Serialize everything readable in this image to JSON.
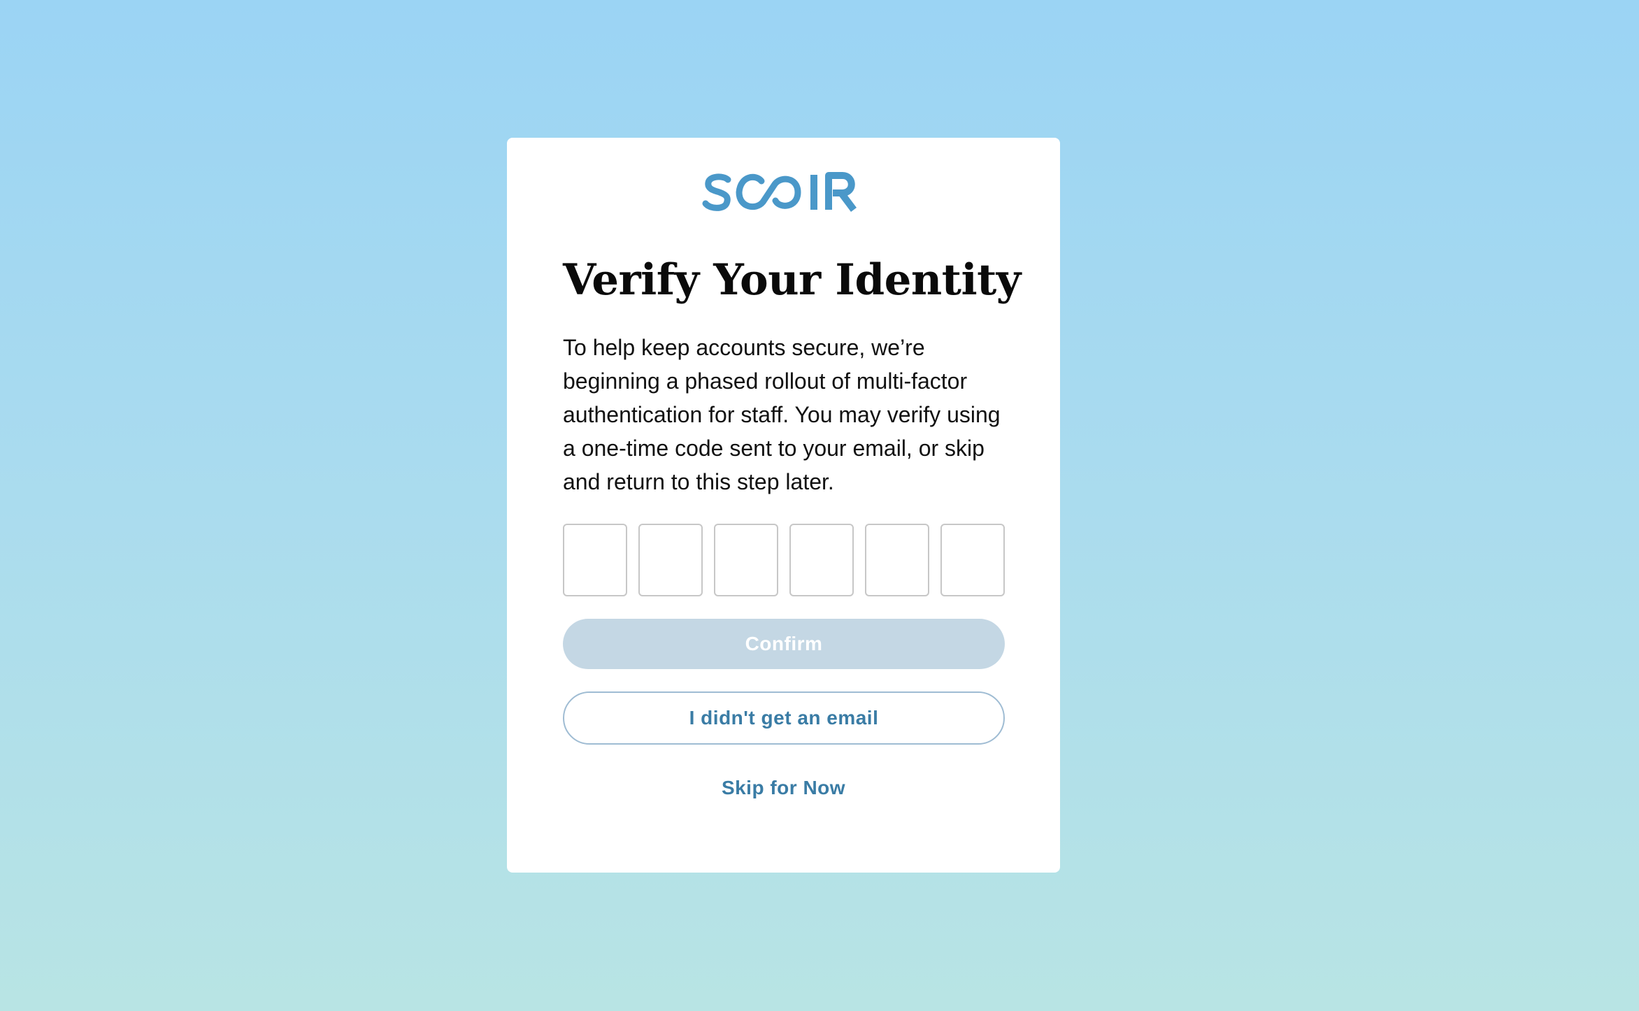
{
  "brand": {
    "logo_text": "SCOIR",
    "color": "#4a98c9"
  },
  "card": {
    "title": "Verify Your Identity",
    "description": "To help keep accounts secure, we’re beginning a phased rollout of multi-factor authentication for staff. You may verify using a one-time code sent to your email, or skip and return to this step later."
  },
  "code_inputs": [
    {
      "value": ""
    },
    {
      "value": ""
    },
    {
      "value": ""
    },
    {
      "value": ""
    },
    {
      "value": ""
    },
    {
      "value": ""
    }
  ],
  "actions": {
    "confirm_label": "Confirm",
    "confirm_state": "disabled",
    "no_email_label": "I didn't get an email",
    "skip_label": "Skip for Now"
  },
  "colors": {
    "background_top": "#9bd4f4",
    "background_bottom": "#b8e4e4",
    "accent": "#3a7ca5",
    "confirm_disabled": "#c4d7e4"
  }
}
